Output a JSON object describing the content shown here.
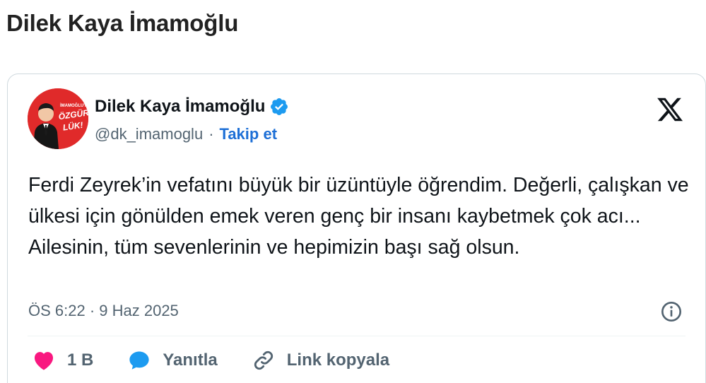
{
  "page": {
    "title": "Dilek Kaya İmamoğlu"
  },
  "tweet": {
    "author": {
      "display_name": "Dilek Kaya İmamoğlu",
      "handle": "@dk_imamoglu",
      "verified": true,
      "avatar_text": [
        "İMAMOĞLU'NA",
        "ÖZGÜR-",
        "LÜK!"
      ]
    },
    "separator": "·",
    "follow_label": "Takip et",
    "text": "Ferdi Zeyrek’in vefatını büyük bir üzüntüyle öğrendim. Değerli, çalışkan ve ülkesi için gönülden emek veren genç bir insanı kaybetmek çok acı... Ailesinin, tüm sevenlerinin ve hepimizin başı sağ olsun.",
    "timestamp": "ÖS 6:22 · 9 Haz 2025",
    "actions": {
      "like_count": "1 B",
      "reply_label": "Yanıtla",
      "copy_link_label": "Link kopyala"
    }
  },
  "icons": {
    "brand": "x-logo-icon",
    "verified": "verified-badge-icon",
    "info": "info-icon",
    "like": "heart-icon",
    "reply": "speech-bubble-icon",
    "copy": "link-icon"
  },
  "colors": {
    "accent_blue": "#1d9bf0",
    "link_blue": "#1d6fd6",
    "like_pink": "#f91880",
    "avatar_red": "#e02a2a",
    "muted_text": "#536471",
    "border": "#cfd9de"
  }
}
